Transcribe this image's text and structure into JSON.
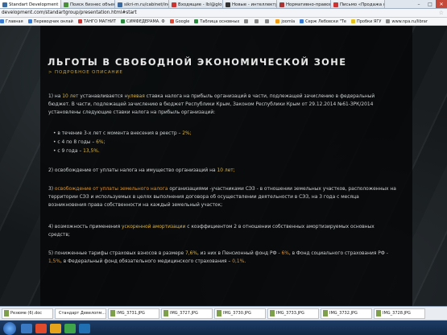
{
  "browser": {
    "tabs": [
      {
        "label": "Standart Development",
        "color": "#3a6aa0",
        "active": true
      },
      {
        "label": "Поиск бизнес объектов",
        "color": "#4a8f3a"
      },
      {
        "label": "sikri-m.ru/cabinet/index",
        "color": "#3a6aa0"
      },
      {
        "label": "Входящие - lbl@glob",
        "color": "#c33"
      },
      {
        "label": "Новые - интеллектуаль",
        "color": "#333"
      },
      {
        "label": "Нормативно-правово",
        "color": "#a33"
      },
      {
        "label": "Письмо «Продажа стр»",
        "color": "#c33"
      }
    ],
    "url": "development.com/standartgroup/presentation.html#start",
    "url_prefix": "",
    "bookmarks": [
      {
        "label": "Главная",
        "color": "#3a7bd5"
      },
      {
        "label": "Переводчик онлай",
        "color": "#3a7bd5"
      },
      {
        "label": "ТАНГО МАГНИТ",
        "color": "#c33"
      },
      {
        "label": "СИМФЕДЕРАМА. Ф",
        "color": "#2b8a3e"
      },
      {
        "label": "Google",
        "color": "#dd4b39"
      },
      {
        "label": "Таблица основных",
        "color": "#2b8a3e"
      },
      {
        "label": "",
        "color": "#888"
      },
      {
        "label": "",
        "color": "#888"
      },
      {
        "label": "",
        "color": "#888"
      },
      {
        "label": "joomla",
        "color": "#f39c12"
      },
      {
        "label": "Серж Лебовски \"Те",
        "color": "#3a7bd5"
      },
      {
        "label": "Пробки ЯГУ",
        "color": "#e6c21c"
      },
      {
        "label": "www.npa.ru/librar",
        "color": "#888"
      }
    ]
  },
  "page": {
    "title": "ЛЬГОТЫ В СВОБОДНОЙ ЭКОНОМИЧЕСКОЙ ЗОНЕ",
    "subtitle": "> ПОДРОБНОЕ ОПИСАНИЕ",
    "p1": {
      "a": "1) на ",
      "b": "10 лет",
      "c": " устанавливается ",
      "d": "нулевая",
      "e": " ставка налога на прибыль организаций в части, подлежащей зачислению в федеральный бюджет. В части, подлежащей зачислению в бюджет Республики Крым, Законом Республики Крым от 29.12.2014 №61-ЗРК/2014 установлены следующие ставки налога на прибыль организаций:"
    },
    "bullets": [
      {
        "a": "• в течение 3-х лет с момента внесения в реестр – ",
        "b": "2%;"
      },
      {
        "a": "• с 4 по 8 годы – ",
        "b": "6%;"
      },
      {
        "a": "• с 9 года – ",
        "b": "13,5%."
      }
    ],
    "p2": {
      "a": "2) освобождение от уплаты налога на имущество организаций на ",
      "b": "10 лет;"
    },
    "p3": {
      "a": "3) ",
      "b": "освобождение от уплаты земельного налога",
      "c": " организациями -участниками СЭЗ - в отношении земельных участков, расположенных на территории СЭЗ и используемых в целях выполнения договора об осуществлении деятельности в СЭЗ, на 3 года с месяца возникновения права собственности на каждый земельный участок;"
    },
    "p4": {
      "a": "4) возможность применения ",
      "b": "ускоренной амортизации",
      "c": " с коэффициентом 2 в отношении собственных амортизируемых основных средств;"
    },
    "p5": {
      "a": "5) пониженные тарифы страховых взносов в размере ",
      "b": "7,6%",
      "c": ", из них в Пенсионный фонд РФ - ",
      "d": "6%",
      "e": ", в Фонд социального страхования РФ - ",
      "f": "1,5%",
      "g": ", в Федеральный фонд обязательного медицинского страхования – ",
      "h": "0,1%",
      "i": "."
    }
  },
  "downloads": {
    "items": [
      "Резюме (6).doc",
      "Стандарт Девелопм....jpg",
      "IMG_3731.JPG",
      "IMG_3727.JPG",
      "IMG_3730.JPG",
      "IMG_3733.JPG",
      "IMG_3732.JPG",
      "IMG_3728.JPG"
    ],
    "show_all": ""
  },
  "taskbar": {
    "clock": ""
  }
}
